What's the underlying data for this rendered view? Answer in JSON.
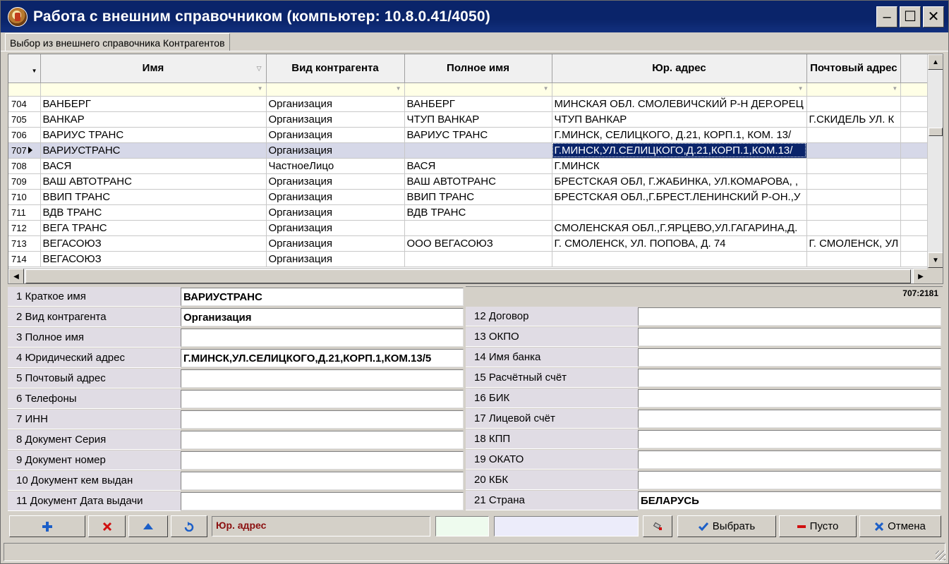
{
  "window": {
    "title": "Работа с внешним справочником (компьютер: 10.8.0.41/4050)",
    "controls": {
      "minimize": "–",
      "maximize": "☐",
      "close": "✕"
    }
  },
  "tab": {
    "label": "Выбор из внешнего справочника Контрагентов"
  },
  "grid": {
    "columns": [
      "Имя",
      "Вид контрагента",
      "Полное имя",
      "Юр. адрес",
      "Почтовый адрес"
    ],
    "rows": [
      {
        "num": "704",
        "name": "ВАНБЕРГ",
        "kind": "Организация",
        "full": "ВАНБЕРГ",
        "addr": "МИНСКАЯ ОБЛ. СМОЛЕВИЧСКИЙ Р-Н ДЕР.ОРЕЦ",
        "post": ""
      },
      {
        "num": "705",
        "name": "ВАНКАР",
        "kind": "Организация",
        "full": "ЧТУП ВАНКАР",
        "addr": "ЧТУП ВАНКАР",
        "post": "Г.СКИДЕЛЬ УЛ. К"
      },
      {
        "num": "706",
        "name": "ВАРИУС ТРАНС",
        "kind": "Организация",
        "full": "ВАРИУС ТРАНС",
        "addr": "Г.МИНСК, СЕЛИЦКОГО, Д.21, КОРП.1, КОМ. 13/",
        "post": ""
      },
      {
        "num": "707",
        "name": "ВАРИУСТРАНС",
        "kind": "Организация",
        "full": "",
        "addr": "Г.МИНСК,УЛ.СЕЛИЦКОГО,Д.21,КОРП.1,КОМ.13/",
        "post": ""
      },
      {
        "num": "708",
        "name": "ВАСЯ",
        "kind": "ЧастноеЛицо",
        "full": "ВАСЯ",
        "addr": "Г.МИНСК",
        "post": ""
      },
      {
        "num": "709",
        "name": "ВАШ АВТОТРАНС",
        "kind": "Организация",
        "full": "ВАШ АВТОТРАНС",
        "addr": "БРЕСТСКАЯ ОБЛ, Г.ЖАБИНКА, УЛ.КОМАРОВА, ,",
        "post": ""
      },
      {
        "num": "710",
        "name": "ВВИП ТРАНС",
        "kind": "Организация",
        "full": "ВВИП ТРАНС",
        "addr": "БРЕСТСКАЯ ОБЛ.,Г.БРЕСТ.ЛЕНИНСКИЙ Р-ОН.,У",
        "post": ""
      },
      {
        "num": "711",
        "name": "ВДВ ТРАНС",
        "kind": "Организация",
        "full": "ВДВ ТРАНС",
        "addr": "",
        "post": ""
      },
      {
        "num": "712",
        "name": "ВЕГА ТРАНС",
        "kind": "Организация",
        "full": "",
        "addr": "СМОЛЕНСКАЯ ОБЛ.,Г.ЯРЦЕВО,УЛ.ГАГАРИНА,Д.",
        "post": ""
      },
      {
        "num": "713",
        "name": "ВЕГАСОЮЗ",
        "kind": "Организация",
        "full": "ООО ВЕГАСОЮЗ",
        "addr": "Г. СМОЛЕНСК, УЛ. ПОПОВА, Д. 74",
        "post": "Г. СМОЛЕНСК, УЛ"
      },
      {
        "num": "714",
        "name": "ВЕГАСОЮЗ",
        "kind": "Организация",
        "full": "",
        "addr": "",
        "post": ""
      }
    ],
    "selected_row": "707"
  },
  "details": {
    "record_pos": "707:2181",
    "left": [
      {
        "label": "1  Краткое имя",
        "value": "ВАРИУСТРАНС"
      },
      {
        "label": "2  Вид контрагента",
        "value": "Организация"
      },
      {
        "label": "3  Полное имя",
        "value": ""
      },
      {
        "label": "4  Юридический адрес",
        "value": "Г.МИНСК,УЛ.СЕЛИЦКОГО,Д.21,КОРП.1,КОМ.13/5"
      },
      {
        "label": "5  Почтовый адрес",
        "value": ""
      },
      {
        "label": "6  Телефоны",
        "value": ""
      },
      {
        "label": "7  ИНН",
        "value": ""
      },
      {
        "label": "8  Документ Серия",
        "value": ""
      },
      {
        "label": "9  Документ номер",
        "value": ""
      },
      {
        "label": "10 Документ кем выдан",
        "value": ""
      },
      {
        "label": "11 Документ Дата выдачи",
        "value": ""
      }
    ],
    "right": [
      {
        "label": "12 Договор",
        "value": ""
      },
      {
        "label": "13 ОКПО",
        "value": ""
      },
      {
        "label": "14 Имя банка",
        "value": ""
      },
      {
        "label": "15 Расчётный счёт",
        "value": ""
      },
      {
        "label": "16 БИК",
        "value": ""
      },
      {
        "label": "17 Лицевой счёт",
        "value": ""
      },
      {
        "label": "18 КПП",
        "value": ""
      },
      {
        "label": "19 ОКАТО",
        "value": ""
      },
      {
        "label": "20 КБК",
        "value": ""
      },
      {
        "label": "21 Страна",
        "value": "БЕЛАРУСЬ"
      }
    ]
  },
  "toolbar": {
    "field_name": "Юр. адрес",
    "select_label": "Выбрать",
    "empty_label": "Пусто",
    "cancel_label": "Отмена"
  },
  "colors": {
    "title_bg": "#0a246a",
    "add_icon": "#1c5fc8",
    "delete_icon": "#d01010",
    "field_name_text": "#8b1010"
  }
}
